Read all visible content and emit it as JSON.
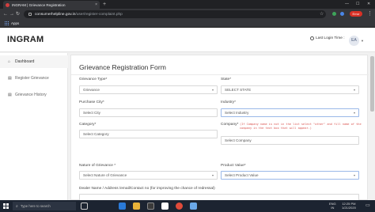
{
  "browser": {
    "tab_title": "INGRAM | Grievance Registration",
    "url_host": "consumerhelpline.gov.in",
    "url_path": "/user/register-complaint.php",
    "error_badge": "Error",
    "bookmark_apps": "Apps"
  },
  "header": {
    "brand": "INGRAM",
    "last_login": "Last Login Time :",
    "avatar_initials": "EA"
  },
  "sidebar": {
    "items": [
      {
        "label": "Dashboard",
        "icon": "home-icon"
      },
      {
        "label": "Register Grievance",
        "icon": "doc-icon"
      },
      {
        "label": "Grievance History",
        "icon": "history-icon"
      }
    ]
  },
  "form": {
    "title": "Grievance Registration Form",
    "grievance_type_label": "Grievance Type*",
    "grievance_type_value": "Grievance",
    "state_label": "State*",
    "state_value": "SELECT STATE",
    "purchase_city_label": "Purchase City*",
    "purchase_city_value": "Select City",
    "industry_label": "Industry*",
    "industry_value": "Select Industry",
    "category_label": "Category*",
    "category_value": "Select Category",
    "company_label": "Company*",
    "company_note": "(If Company name is not in the list select \"other\" and fill name of the company in the text box that will appear.)",
    "company_value": "Select Company",
    "nature_label": "Nature of Grievance *",
    "nature_value": "Select Nature of Grievance",
    "product_label": "Product Value*",
    "product_value": "Select Product Value",
    "dealer_label": "Dealer Name / Address /email/Contact no (for improving the chance of redressal)"
  },
  "taskbar": {
    "search_placeholder": "Type here to search",
    "lang": "ENG",
    "region": "IN",
    "time": "12:25 PM",
    "date": "1/21/2020"
  },
  "colors": {
    "brand_text": "#222222",
    "required_note": "#d9534f",
    "taskbar": "#1c2431"
  }
}
